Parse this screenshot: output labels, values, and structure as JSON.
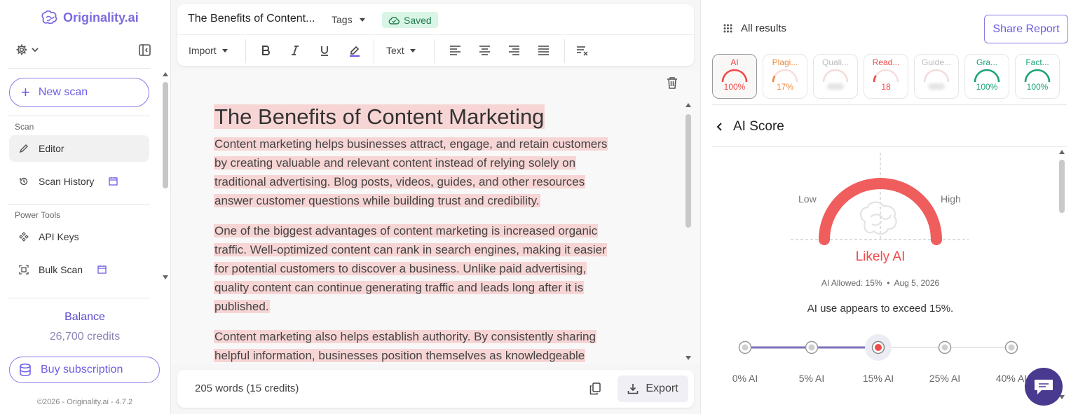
{
  "app": {
    "name": "Originality.ai",
    "version_footer": "©2026 - Originality.ai - 4.7.2"
  },
  "colors": {
    "brand": "#6c5ce7",
    "ai_red": "#ef4a4a",
    "highlight": "#f7d5d5",
    "saved_green": "#1f7a4d",
    "pass_green": "#1aa37a",
    "plagiarism_orange": "#f08a3c"
  },
  "sidebar": {
    "new_scan_label": "New scan",
    "section_scan": "Scan",
    "section_power": "Power Tools",
    "items": [
      {
        "label": "Editor",
        "icon": "pencil-icon",
        "active": true
      },
      {
        "label": "Scan History",
        "icon": "history-icon",
        "badge_icon": "calendar-icon"
      },
      {
        "label": "API Keys",
        "icon": "api-icon"
      },
      {
        "label": "Bulk Scan",
        "icon": "bulk-scan-icon",
        "badge_icon": "calendar-icon"
      }
    ],
    "balance_label": "Balance",
    "balance_value": "26,700 credits",
    "buy_label": "Buy subscription"
  },
  "editor": {
    "title": "The Benefits of Content...",
    "tags_label": "Tags",
    "saved_label": "Saved",
    "import_label": "Import",
    "text_style_label": "Text",
    "heading": "The Benefits of Content Marketing",
    "paragraphs": [
      "Content marketing helps businesses attract, engage, and retain customers by creating valuable and relevant content instead of relying solely on traditional advertising. Blog posts, videos, guides, and other resources answer customer questions while building trust and credibility.",
      "One of the biggest advantages of content marketing is increased organic traffic. Well-optimized content can rank in search engines, making it easier for potential customers to discover a business. Unlike paid advertising, quality content can continue generating traffic and leads long after it is published.",
      "Content marketing also helps establish authority. By consistently sharing helpful information, businesses position themselves as knowledgeable"
    ],
    "word_count": "205 words (15 credits)",
    "export_label": "Export"
  },
  "results": {
    "all_results_label": "All results",
    "share_label": "Share Report",
    "cards": [
      {
        "label": "AI",
        "value": "100%",
        "fraction": 1.0,
        "color": "#ef4a4a",
        "active": true
      },
      {
        "label": "Plagi...",
        "value": "17%",
        "fraction": 0.17,
        "color": "#f08a3c"
      },
      {
        "label": "Quali...",
        "value": "",
        "fraction": 0,
        "color": "#bbbbbb"
      },
      {
        "label": "Read...",
        "value": "18",
        "fraction": 0.18,
        "color": "#ef4a4a"
      },
      {
        "label": "Guide...",
        "value": "",
        "fraction": 0,
        "color": "#bbbbbb"
      },
      {
        "label": "Gra...",
        "value": "100%",
        "fraction": 1.0,
        "color": "#1aa37a"
      },
      {
        "label": "Fact...",
        "value": "100%",
        "fraction": 1.0,
        "color": "#1aa37a"
      }
    ],
    "section_title": "AI Score",
    "gauge": {
      "low_label": "Low",
      "high_label": "High",
      "ai_fraction": 1.0
    },
    "verdict": "Likely AI",
    "allowed": "AI Allowed: 15%",
    "date": "Aug 5, 2026",
    "separator": "•",
    "exceed_text": "AI use appears to exceed 15%.",
    "thresholds": [
      {
        "label": "0% AI"
      },
      {
        "label": "5% AI"
      },
      {
        "label": "15% AI",
        "selected": true
      },
      {
        "label": "25% AI"
      },
      {
        "label": "40% AI"
      }
    ]
  }
}
